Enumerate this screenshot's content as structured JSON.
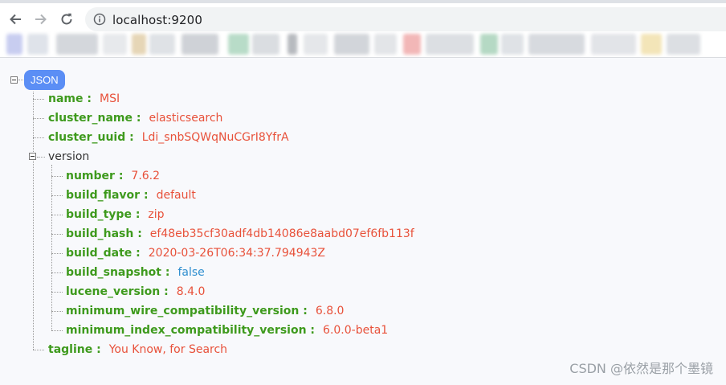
{
  "browser": {
    "url": "localhost:9200",
    "nav": [
      "back-icon",
      "forward-icon",
      "reload-icon",
      "info-icon"
    ]
  },
  "tree": {
    "root_label": "JSON",
    "name_key": "name :",
    "name_val": "MSI",
    "cluster_name_key": "cluster_name :",
    "cluster_name_val": "elasticsearch",
    "cluster_uuid_key": "cluster_uuid :",
    "cluster_uuid_val": "Ldi_snbSQWqNuCGrI8YfrA",
    "version_key": "version",
    "version": {
      "number_key": "number :",
      "number_val": "7.6.2",
      "build_flavor_key": "build_flavor :",
      "build_flavor_val": "default",
      "build_type_key": "build_type :",
      "build_type_val": "zip",
      "build_hash_key": "build_hash :",
      "build_hash_val": "ef48eb35cf30adf4db14086e8aabd07ef6fb113f",
      "build_date_key": "build_date :",
      "build_date_val": "2020-03-26T06:34:37.794943Z",
      "build_snapshot_key": "build_snapshot :",
      "build_snapshot_val": "false",
      "lucene_version_key": "lucene_version :",
      "lucene_version_val": "8.4.0",
      "min_wire_key": "minimum_wire_compatibility_version :",
      "min_wire_val": "6.8.0",
      "min_index_key": "minimum_index_compatibility_version :",
      "min_index_val": "6.0.0-beta1"
    },
    "tagline_key": "tagline :",
    "tagline_val": "You Know, for Search"
  },
  "watermark": "CSDN @依然是那个墨镜",
  "colors": {
    "key": "#3e9a1d",
    "string": "#e8513a",
    "boolean": "#2f8ecf",
    "badge": "#5b8ef5"
  }
}
